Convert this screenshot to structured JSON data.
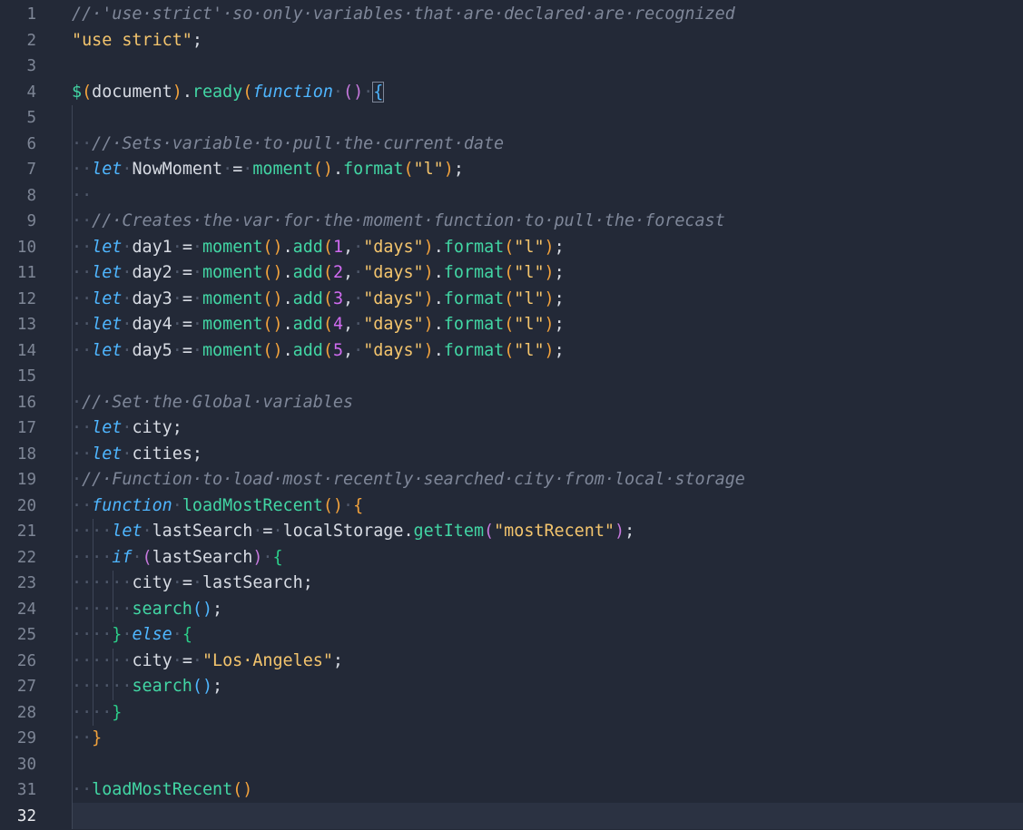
{
  "editor": {
    "language": "javascript",
    "active_line": 32,
    "lines": [
      {
        "n": "1",
        "tokens": [
          [
            "cm",
            "//·'use·strict'·so·only·variables·that·are·declared·are·recognized"
          ]
        ]
      },
      {
        "n": "2",
        "tokens": [
          [
            "str",
            "\"use strict\""
          ],
          [
            "pn",
            ";"
          ]
        ]
      },
      {
        "n": "3",
        "tokens": []
      },
      {
        "n": "4",
        "tokens": [
          [
            "dollar",
            "$"
          ],
          [
            "b1",
            "("
          ],
          [
            "vb",
            "document"
          ],
          [
            "b1",
            ")"
          ],
          [
            "pn",
            "."
          ],
          [
            "fn",
            "ready"
          ],
          [
            "b1",
            "("
          ],
          [
            "kw",
            "function"
          ],
          [
            "ws",
            "·"
          ],
          [
            "b2",
            "()"
          ],
          [
            "ws",
            "·"
          ],
          [
            "b4",
            "{"
          ]
        ]
      },
      {
        "n": "5",
        "tokens": []
      },
      {
        "n": "6",
        "tokens": [
          [
            "ws",
            "··"
          ],
          [
            "cm",
            "//·Sets·variable·to·pull·the·current·date"
          ]
        ]
      },
      {
        "n": "7",
        "tokens": [
          [
            "ws",
            "··"
          ],
          [
            "kw",
            "let"
          ],
          [
            "ws",
            "·"
          ],
          [
            "vb",
            "NowMoment"
          ],
          [
            "ws",
            "·"
          ],
          [
            "pn",
            "="
          ],
          [
            "ws",
            "·"
          ],
          [
            "fn",
            "moment"
          ],
          [
            "b1",
            "()"
          ],
          [
            "pn",
            "."
          ],
          [
            "fn",
            "format"
          ],
          [
            "b1",
            "("
          ],
          [
            "str",
            "\"l\""
          ],
          [
            "b1",
            ")"
          ],
          [
            "pn",
            ";"
          ]
        ]
      },
      {
        "n": "8",
        "tokens": [
          [
            "ws",
            "··"
          ]
        ]
      },
      {
        "n": "9",
        "tokens": [
          [
            "ws",
            "··"
          ],
          [
            "cm",
            "//·Creates·the·var·for·the·moment·function·to·pull·the·forecast"
          ]
        ]
      },
      {
        "n": "10",
        "tokens": [
          [
            "ws",
            "··"
          ],
          [
            "kw",
            "let"
          ],
          [
            "ws",
            "·"
          ],
          [
            "vb",
            "day1"
          ],
          [
            "ws",
            "·"
          ],
          [
            "pn",
            "="
          ],
          [
            "ws",
            "·"
          ],
          [
            "fn",
            "moment"
          ],
          [
            "b1",
            "()"
          ],
          [
            "pn",
            "."
          ],
          [
            "fn",
            "add"
          ],
          [
            "b1",
            "("
          ],
          [
            "num",
            "1"
          ],
          [
            "pn",
            ","
          ],
          [
            "ws",
            "·"
          ],
          [
            "str",
            "\"days\""
          ],
          [
            "b1",
            ")"
          ],
          [
            "pn",
            "."
          ],
          [
            "fn",
            "format"
          ],
          [
            "b1",
            "("
          ],
          [
            "str",
            "\"l\""
          ],
          [
            "b1",
            ")"
          ],
          [
            "pn",
            ";"
          ]
        ]
      },
      {
        "n": "11",
        "tokens": [
          [
            "ws",
            "··"
          ],
          [
            "kw",
            "let"
          ],
          [
            "ws",
            "·"
          ],
          [
            "vb",
            "day2"
          ],
          [
            "ws",
            "·"
          ],
          [
            "pn",
            "="
          ],
          [
            "ws",
            "·"
          ],
          [
            "fn",
            "moment"
          ],
          [
            "b1",
            "()"
          ],
          [
            "pn",
            "."
          ],
          [
            "fn",
            "add"
          ],
          [
            "b1",
            "("
          ],
          [
            "num",
            "2"
          ],
          [
            "pn",
            ","
          ],
          [
            "ws",
            "·"
          ],
          [
            "str",
            "\"days\""
          ],
          [
            "b1",
            ")"
          ],
          [
            "pn",
            "."
          ],
          [
            "fn",
            "format"
          ],
          [
            "b1",
            "("
          ],
          [
            "str",
            "\"l\""
          ],
          [
            "b1",
            ")"
          ],
          [
            "pn",
            ";"
          ]
        ]
      },
      {
        "n": "12",
        "tokens": [
          [
            "ws",
            "··"
          ],
          [
            "kw",
            "let"
          ],
          [
            "ws",
            "·"
          ],
          [
            "vb",
            "day3"
          ],
          [
            "ws",
            "·"
          ],
          [
            "pn",
            "="
          ],
          [
            "ws",
            "·"
          ],
          [
            "fn",
            "moment"
          ],
          [
            "b1",
            "()"
          ],
          [
            "pn",
            "."
          ],
          [
            "fn",
            "add"
          ],
          [
            "b1",
            "("
          ],
          [
            "num",
            "3"
          ],
          [
            "pn",
            ","
          ],
          [
            "ws",
            "·"
          ],
          [
            "str",
            "\"days\""
          ],
          [
            "b1",
            ")"
          ],
          [
            "pn",
            "."
          ],
          [
            "fn",
            "format"
          ],
          [
            "b1",
            "("
          ],
          [
            "str",
            "\"l\""
          ],
          [
            "b1",
            ")"
          ],
          [
            "pn",
            ";"
          ]
        ]
      },
      {
        "n": "13",
        "tokens": [
          [
            "ws",
            "··"
          ],
          [
            "kw",
            "let"
          ],
          [
            "ws",
            "·"
          ],
          [
            "vb",
            "day4"
          ],
          [
            "ws",
            "·"
          ],
          [
            "pn",
            "="
          ],
          [
            "ws",
            "·"
          ],
          [
            "fn",
            "moment"
          ],
          [
            "b1",
            "()"
          ],
          [
            "pn",
            "."
          ],
          [
            "fn",
            "add"
          ],
          [
            "b1",
            "("
          ],
          [
            "num",
            "4"
          ],
          [
            "pn",
            ","
          ],
          [
            "ws",
            "·"
          ],
          [
            "str",
            "\"days\""
          ],
          [
            "b1",
            ")"
          ],
          [
            "pn",
            "."
          ],
          [
            "fn",
            "format"
          ],
          [
            "b1",
            "("
          ],
          [
            "str",
            "\"l\""
          ],
          [
            "b1",
            ")"
          ],
          [
            "pn",
            ";"
          ]
        ]
      },
      {
        "n": "14",
        "tokens": [
          [
            "ws",
            "··"
          ],
          [
            "kw",
            "let"
          ],
          [
            "ws",
            "·"
          ],
          [
            "vb",
            "day5"
          ],
          [
            "ws",
            "·"
          ],
          [
            "pn",
            "="
          ],
          [
            "ws",
            "·"
          ],
          [
            "fn",
            "moment"
          ],
          [
            "b1",
            "()"
          ],
          [
            "pn",
            "."
          ],
          [
            "fn",
            "add"
          ],
          [
            "b1",
            "("
          ],
          [
            "num",
            "5"
          ],
          [
            "pn",
            ","
          ],
          [
            "ws",
            "·"
          ],
          [
            "str",
            "\"days\""
          ],
          [
            "b1",
            ")"
          ],
          [
            "pn",
            "."
          ],
          [
            "fn",
            "format"
          ],
          [
            "b1",
            "("
          ],
          [
            "str",
            "\"l\""
          ],
          [
            "b1",
            ")"
          ],
          [
            "pn",
            ";"
          ]
        ]
      },
      {
        "n": "15",
        "tokens": []
      },
      {
        "n": "16",
        "tokens": [
          [
            "ws",
            "·"
          ],
          [
            "cm",
            "//·Set·the·Global·variables"
          ]
        ]
      },
      {
        "n": "17",
        "tokens": [
          [
            "ws",
            "··"
          ],
          [
            "kw",
            "let"
          ],
          [
            "ws",
            "·"
          ],
          [
            "vb",
            "city"
          ],
          [
            "pn",
            ";"
          ]
        ]
      },
      {
        "n": "18",
        "tokens": [
          [
            "ws",
            "··"
          ],
          [
            "kw",
            "let"
          ],
          [
            "ws",
            "·"
          ],
          [
            "vb",
            "cities"
          ],
          [
            "pn",
            ";"
          ]
        ]
      },
      {
        "n": "19",
        "tokens": [
          [
            "ws",
            "·"
          ],
          [
            "cm",
            "//·Function·to·load·most·recently·searched·city·from·local·storage"
          ]
        ]
      },
      {
        "n": "20",
        "tokens": [
          [
            "ws",
            "··"
          ],
          [
            "kw",
            "function"
          ],
          [
            "ws",
            "·"
          ],
          [
            "fn",
            "loadMostRecent"
          ],
          [
            "b1",
            "()"
          ],
          [
            "ws",
            "·"
          ],
          [
            "b1",
            "{"
          ]
        ]
      },
      {
        "n": "21",
        "tokens": [
          [
            "ws",
            "····"
          ],
          [
            "kw",
            "let"
          ],
          [
            "ws",
            "·"
          ],
          [
            "vb",
            "lastSearch"
          ],
          [
            "ws",
            "·"
          ],
          [
            "pn",
            "="
          ],
          [
            "ws",
            "·"
          ],
          [
            "vb",
            "localStorage"
          ],
          [
            "pn",
            "."
          ],
          [
            "fn",
            "getItem"
          ],
          [
            "b2",
            "("
          ],
          [
            "str",
            "\"mostRecent\""
          ],
          [
            "b2",
            ")"
          ],
          [
            "pn",
            ";"
          ]
        ]
      },
      {
        "n": "22",
        "tokens": [
          [
            "ws",
            "····"
          ],
          [
            "kw",
            "if"
          ],
          [
            "ws",
            "·"
          ],
          [
            "b2",
            "("
          ],
          [
            "vb",
            "lastSearch"
          ],
          [
            "b2",
            ")"
          ],
          [
            "ws",
            "·"
          ],
          [
            "b3",
            "{"
          ]
        ]
      },
      {
        "n": "23",
        "tokens": [
          [
            "ws",
            "······"
          ],
          [
            "vb",
            "city"
          ],
          [
            "ws",
            "·"
          ],
          [
            "pn",
            "="
          ],
          [
            "ws",
            "·"
          ],
          [
            "vb",
            "lastSearch"
          ],
          [
            "pn",
            ";"
          ]
        ]
      },
      {
        "n": "24",
        "tokens": [
          [
            "ws",
            "······"
          ],
          [
            "fn",
            "search"
          ],
          [
            "b4",
            "()"
          ],
          [
            "pn",
            ";"
          ]
        ]
      },
      {
        "n": "25",
        "tokens": [
          [
            "ws",
            "····"
          ],
          [
            "b3",
            "}"
          ],
          [
            "ws",
            "·"
          ],
          [
            "kw",
            "else"
          ],
          [
            "ws",
            "·"
          ],
          [
            "b3",
            "{"
          ]
        ]
      },
      {
        "n": "26",
        "tokens": [
          [
            "ws",
            "······"
          ],
          [
            "vb",
            "city"
          ],
          [
            "ws",
            "·"
          ],
          [
            "pn",
            "="
          ],
          [
            "ws",
            "·"
          ],
          [
            "str",
            "\"Los·Angeles\""
          ],
          [
            "pn",
            ";"
          ]
        ]
      },
      {
        "n": "27",
        "tokens": [
          [
            "ws",
            "······"
          ],
          [
            "fn",
            "search"
          ],
          [
            "b4",
            "()"
          ],
          [
            "pn",
            ";"
          ]
        ]
      },
      {
        "n": "28",
        "tokens": [
          [
            "ws",
            "····"
          ],
          [
            "b3",
            "}"
          ]
        ]
      },
      {
        "n": "29",
        "tokens": [
          [
            "ws",
            "··"
          ],
          [
            "b1",
            "}"
          ]
        ]
      },
      {
        "n": "30",
        "tokens": []
      },
      {
        "n": "31",
        "tokens": [
          [
            "ws",
            "··"
          ],
          [
            "fn",
            "loadMostRecent"
          ],
          [
            "b1",
            "()"
          ]
        ]
      },
      {
        "n": "32",
        "tokens": []
      }
    ]
  }
}
